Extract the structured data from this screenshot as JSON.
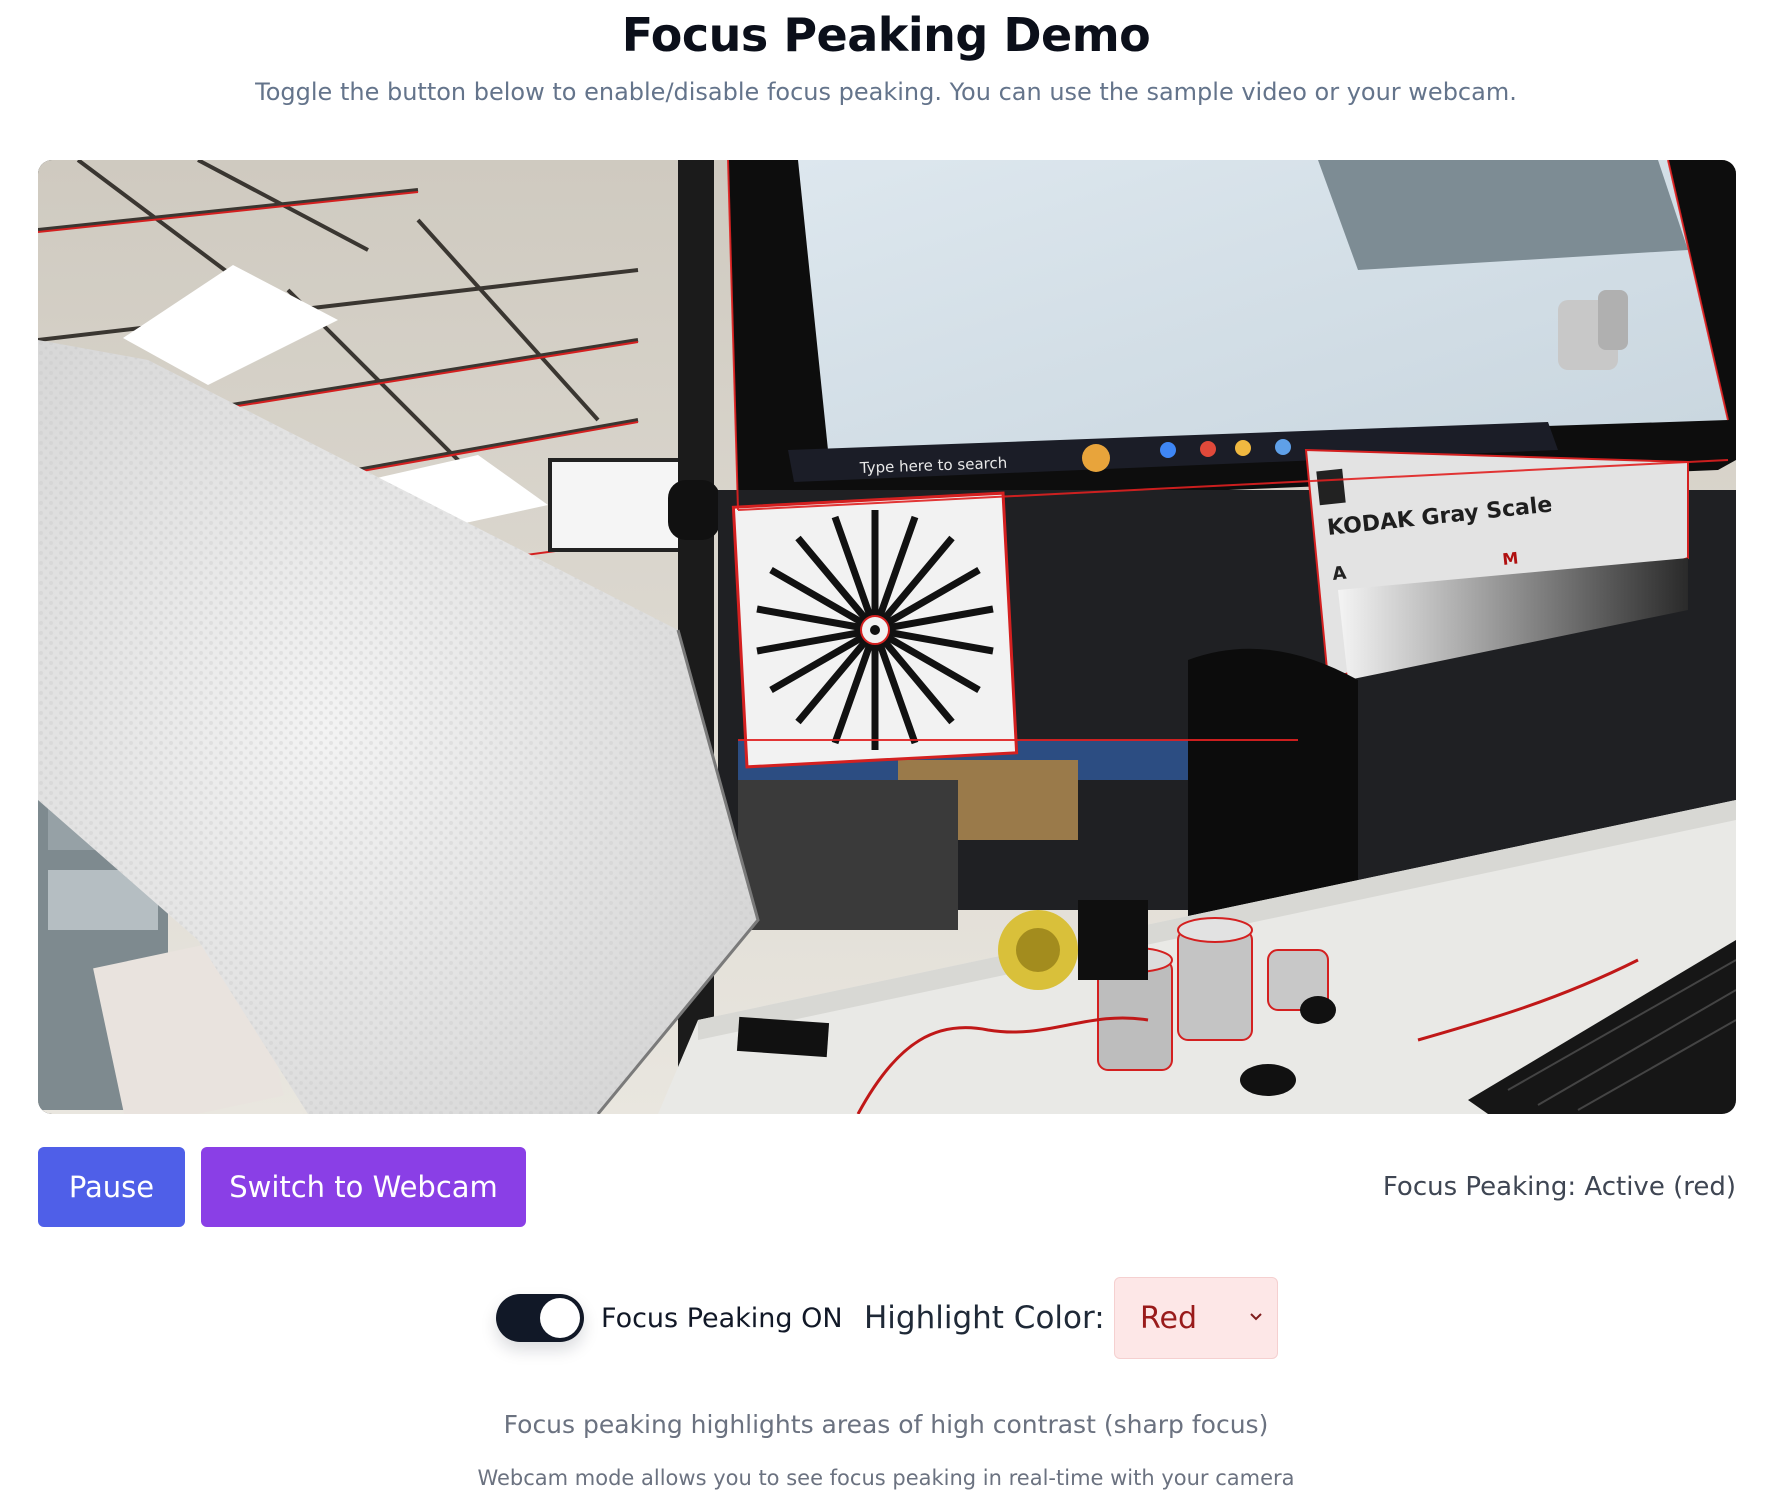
{
  "header": {
    "title": "Focus Peaking Demo",
    "subtitle": "Toggle the button below to enable/disable focus peaking. You can use the sample video or your webcam."
  },
  "video": {
    "taskbar_search_text": "Type here to search",
    "chart_label": "KODAK Gray Scale",
    "chart_letter": "A",
    "chart_marker": "M"
  },
  "controls": {
    "pause_label": "Pause",
    "switch_label": "Switch to Webcam",
    "status_text": "Focus Peaking: Active (red)"
  },
  "settings": {
    "toggle_state": "on",
    "toggle_label": "Focus Peaking ON",
    "color_label": "Highlight Color:",
    "color_value": "Red"
  },
  "help": {
    "line1": "Focus peaking highlights areas of high contrast (sharp focus)",
    "line2": "Webcam mode allows you to see focus peaking in real-time with your camera"
  },
  "colors": {
    "pause_button": "#4f5fe8",
    "webcam_button": "#8a3fe6",
    "peaking_highlight": "#e02020",
    "toggle_on": "#111827",
    "select_background": "#fde7e7"
  }
}
